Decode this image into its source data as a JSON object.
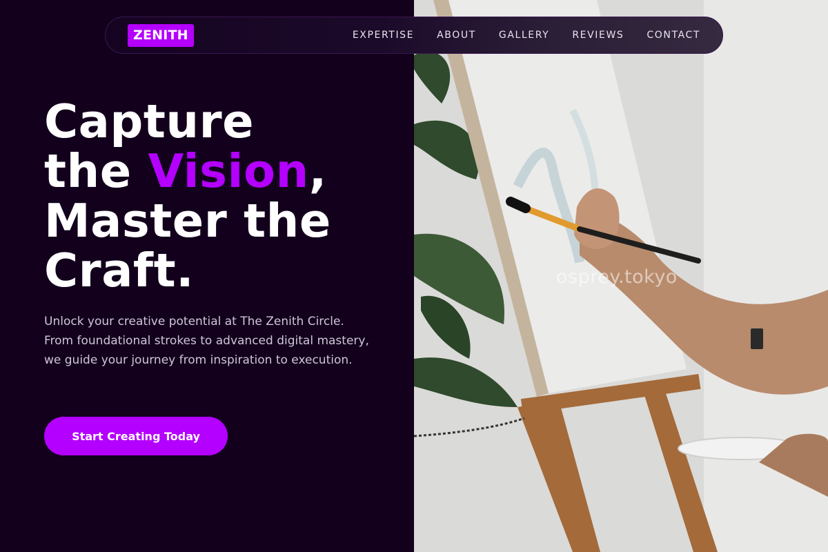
{
  "nav": {
    "logo": "ZENITH",
    "links": [
      "EXPERTISE",
      "ABOUT",
      "GALLERY",
      "REVIEWS",
      "CONTACT"
    ]
  },
  "hero": {
    "title_line1": "Capture",
    "title_line2_prefix": "the ",
    "title_line2_accent": "Vision",
    "title_line2_suffix": ",",
    "title_line3": "Master the",
    "title_line4": "Craft.",
    "description": "Unlock your creative potential at The Zenith Circle. From foundational strokes to advanced digital mastery, we guide your journey from inspiration to execution.",
    "cta_label": "Start Creating Today"
  },
  "image": {
    "watermark": "osprey.tokyo",
    "subject": "hand-painting-on-easel-photo"
  },
  "colors": {
    "background": "#12001c",
    "accent": "#b400ff",
    "text": "#ffffff",
    "muted_text": "#cfc6d8"
  }
}
